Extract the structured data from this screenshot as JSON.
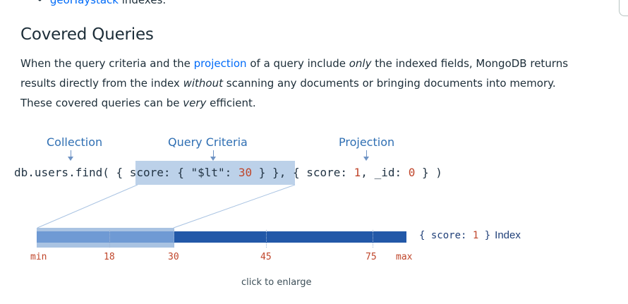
{
  "prev_bullet": {
    "bullet": "•",
    "link": "geoHaystack",
    "suffix": " indexes."
  },
  "section": {
    "title": "Covered Queries"
  },
  "paragraph": {
    "p1": "When the query criteria and the ",
    "link": "projection",
    "p2": " of a query include ",
    "em1": "only",
    "p3": " the indexed fields, MongoDB returns results directly from the index ",
    "em2": "without",
    "p4": " scanning any documents or bringing documents into memory. These covered queries can be ",
    "em3": "very",
    "p5": " efficient."
  },
  "diagram": {
    "labels": {
      "collection": "Collection",
      "criteria": "Query Criteria",
      "projection": "Projection"
    },
    "code": {
      "c1": "db.users.find( { ",
      "c2": "score: { \"$lt\": ",
      "c3": "30",
      "c4": " } },",
      "c5": " { score: ",
      "c6": "1",
      "c7": ", _id: ",
      "c8": "0",
      "c9": " } )"
    },
    "index_label": {
      "open": "{ score: ",
      "num": "1",
      "close": " }",
      "name": "Index"
    },
    "axis_ticks": [
      "min",
      "18",
      "30",
      "45",
      "75",
      "max"
    ]
  },
  "enlarge_text": "click to enlarge"
}
